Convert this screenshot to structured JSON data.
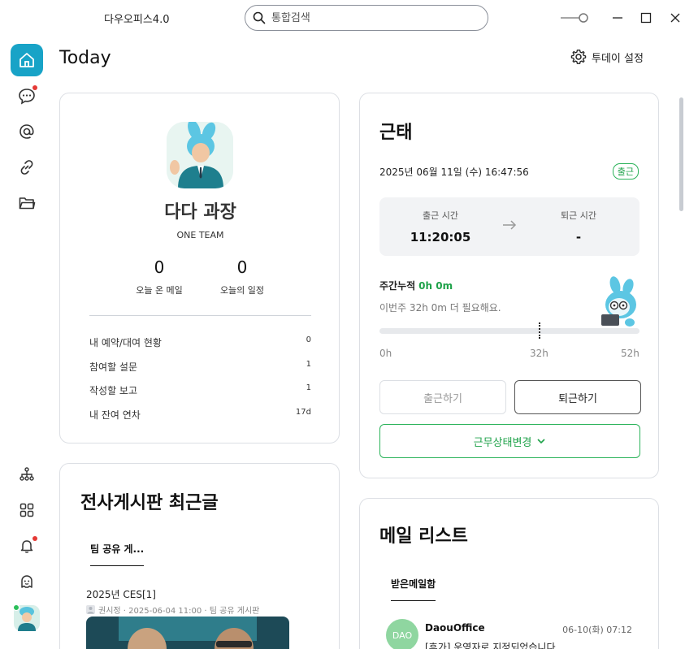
{
  "app": {
    "title": "다우오피스4.0"
  },
  "search": {
    "placeholder": "통합검색"
  },
  "page": {
    "title": "Today",
    "settings_label": "투데이 설정"
  },
  "profile": {
    "name": "다다 과장",
    "team": "ONE TEAM",
    "stats": [
      {
        "value": "0",
        "label": "오늘 온 메일"
      },
      {
        "value": "0",
        "label": "오늘의 일정"
      }
    ],
    "rows": [
      {
        "label": "내 예약/대여 현황",
        "value": "0"
      },
      {
        "label": "참여할 설문",
        "value": "1"
      },
      {
        "label": "작성할 보고",
        "value": "1"
      },
      {
        "label": "내 잔여 연차",
        "value": "17d"
      }
    ]
  },
  "attendance": {
    "title": "근태",
    "datetime": "2025년 06월 11일 (수) 16:47:56",
    "status_badge": "출근",
    "check_in_label": "출근 시간",
    "check_in_value": "11:20:05",
    "check_out_label": "퇴근 시간",
    "check_out_value": "-",
    "weekly_label": "주간누적",
    "weekly_value": "0h 0m",
    "weekly_note": "이번주 32h 0m 더 필요해요.",
    "weekly_progress": 0,
    "target_marker_hours": 32,
    "max_hours": 52,
    "ticks": [
      "0h",
      "32h",
      "52h"
    ],
    "btn_checkin": "출근하기",
    "btn_checkout": "퇴근하기",
    "btn_status": "근무상태변경"
  },
  "board": {
    "title": "전사게시판 최근글",
    "tab": "팀 공유 게...",
    "post": {
      "title": "2025년 CES[1]",
      "meta": "권시정 · 2025-06-04 11:00 · 팀 공유 게시판"
    }
  },
  "mail": {
    "title": "메일 리스트",
    "tab": "받은메일함",
    "item": {
      "avatar": "DAO",
      "from": "DaouOffice",
      "date": "06-10(화) 07:12",
      "subject": "[휴가] 운영자로 지정되었습니다."
    }
  },
  "colors": {
    "accent": "#18a3c7",
    "green": "#1fa24a",
    "alert": "#e53935"
  }
}
